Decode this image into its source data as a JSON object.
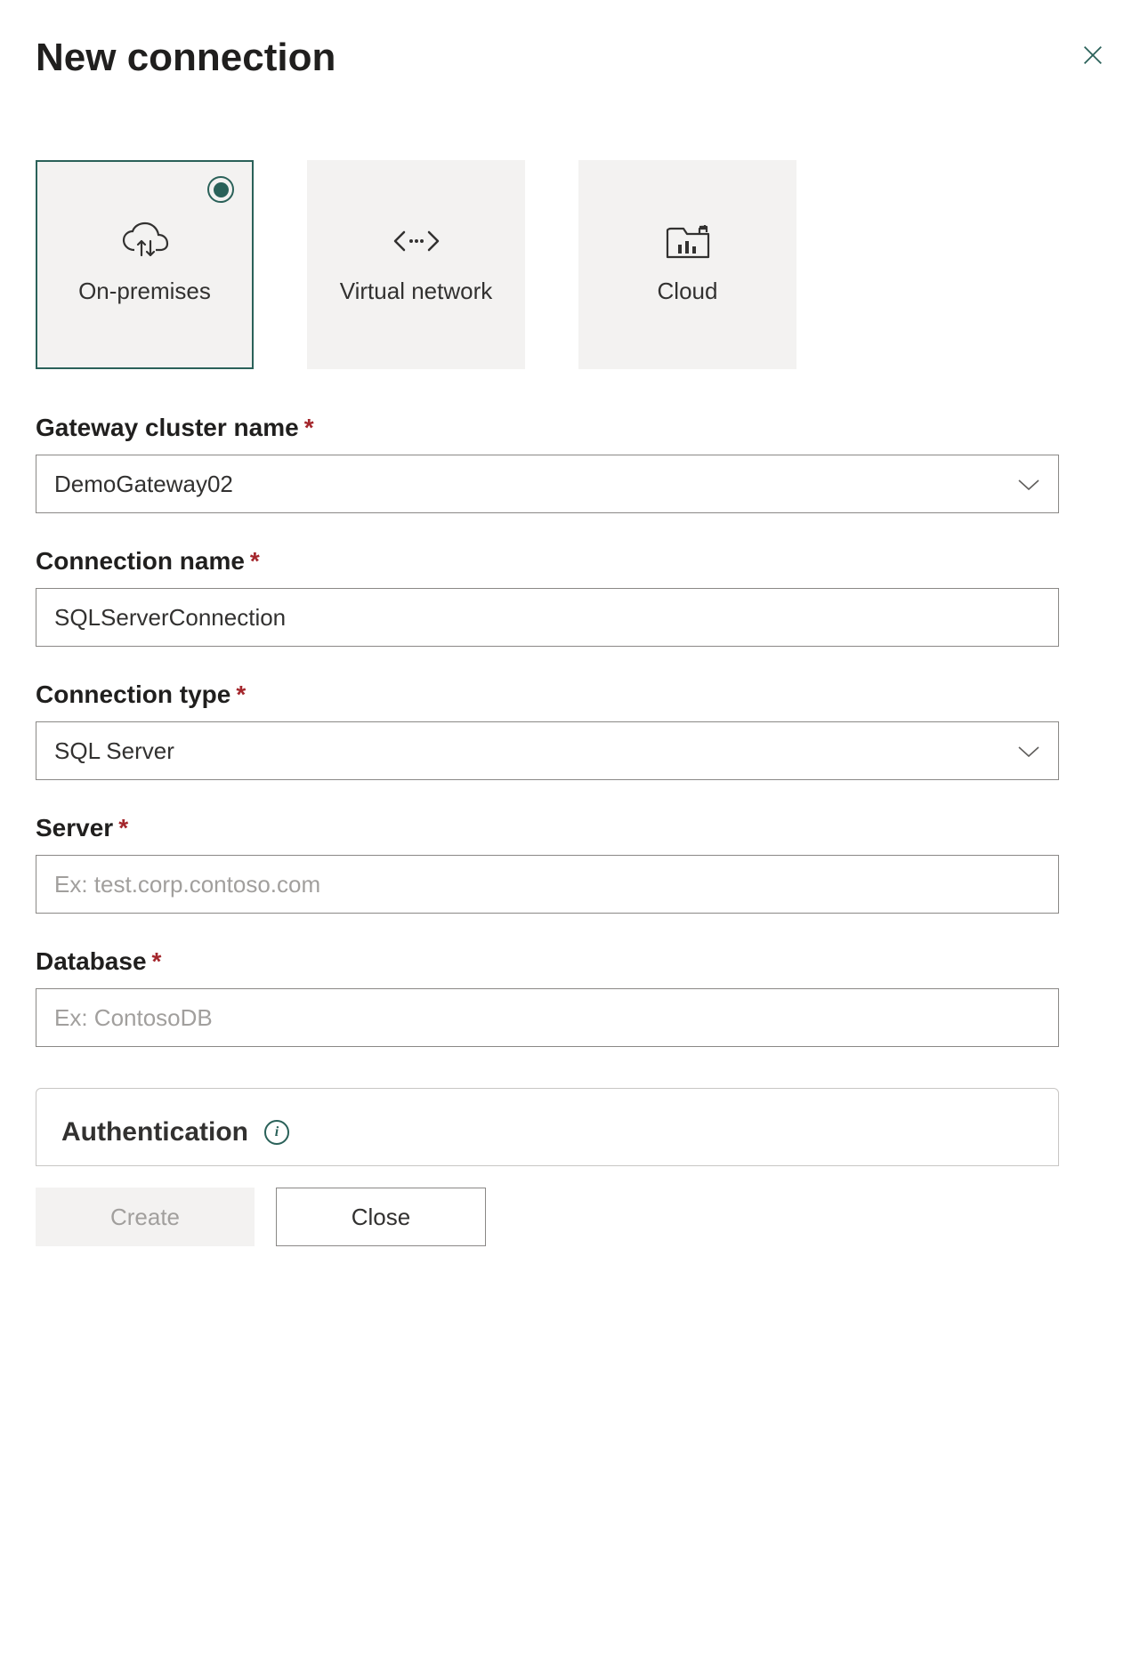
{
  "header": {
    "title": "New connection"
  },
  "typeCards": {
    "onPremises": {
      "label": "On-premises"
    },
    "virtualNetwork": {
      "label": "Virtual network"
    },
    "cloud": {
      "label": "Cloud"
    }
  },
  "form": {
    "gatewayCluster": {
      "label": "Gateway cluster name",
      "value": "DemoGateway02"
    },
    "connectionName": {
      "label": "Connection name",
      "value": "SQLServerConnection"
    },
    "connectionType": {
      "label": "Connection type",
      "value": "SQL Server"
    },
    "server": {
      "label": "Server",
      "value": "",
      "placeholder": "Ex: test.corp.contoso.com"
    },
    "database": {
      "label": "Database",
      "value": "",
      "placeholder": "Ex: ContosoDB"
    },
    "authentication": {
      "label": "Authentication"
    }
  },
  "buttons": {
    "create": "Create",
    "close": "Close"
  }
}
